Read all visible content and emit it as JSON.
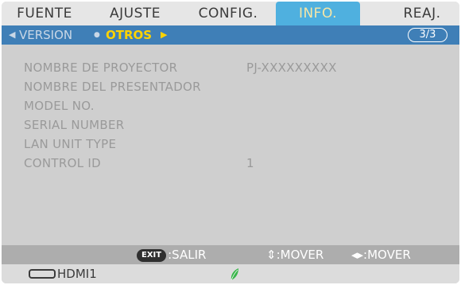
{
  "tabs": [
    {
      "label": "FUENTE",
      "active": false
    },
    {
      "label": "AJUSTE",
      "active": false
    },
    {
      "label": "CONFIG.",
      "active": false
    },
    {
      "label": "INFO.",
      "active": true
    },
    {
      "label": "REAJ.",
      "active": false
    }
  ],
  "subtabs": {
    "left_arrow": "◀",
    "items": [
      {
        "label": "VERSION",
        "active": false
      },
      {
        "label": "OTROS",
        "active": true
      }
    ],
    "separator": "●",
    "right_arrow": "▶",
    "page_indicator": "3/3"
  },
  "info": [
    {
      "label": "NOMBRE DE PROYECTOR",
      "value": "PJ-XXXXXXXXX"
    },
    {
      "label": "NOMBRE DEL PRESENTADOR",
      "value": ""
    },
    {
      "label": "MODEL NO.",
      "value": ""
    },
    {
      "label": "SERIAL NUMBER",
      "value": ""
    },
    {
      "label": "LAN UNIT TYPE",
      "value": ""
    },
    {
      "label": "CONTROL ID",
      "value": "1"
    }
  ],
  "footer": {
    "exit_key": "EXIT",
    "exit_hint": ":SALIR",
    "updown_hint": "⇕:MOVER",
    "leftright_hint": "◂▸:MOVER"
  },
  "status": {
    "source_icon": "hdmi-port-icon",
    "source_label": "HDMI1",
    "eco_icon": "eco-leaf-icon"
  },
  "colors": {
    "active_tab": "#4fb0df",
    "active_tab_text": "#f6e6a6",
    "subtab_bar": "#3f7fb7",
    "active_subtab_text": "#ffd300",
    "eco_leaf": "#39b54a"
  }
}
